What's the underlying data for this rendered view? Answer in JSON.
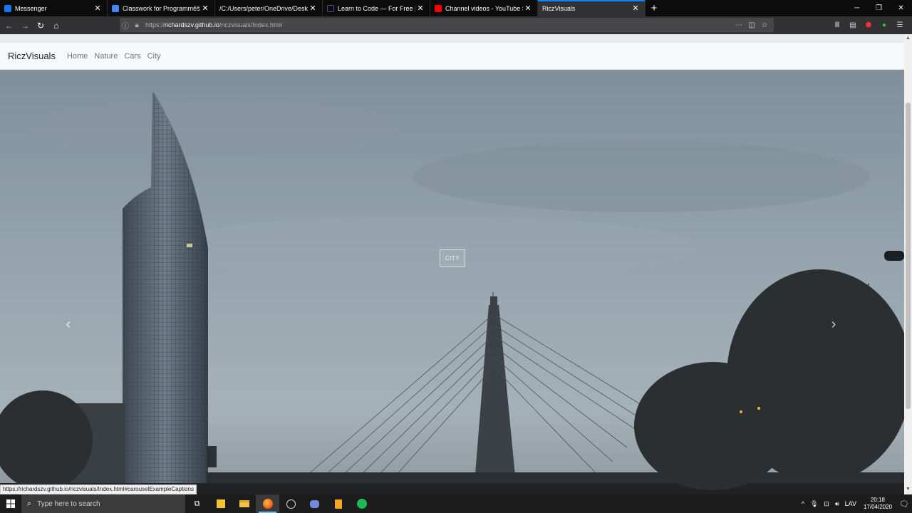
{
  "browser": {
    "tabs": [
      {
        "title": "Messenger",
        "color": "#1877f2",
        "active": false
      },
      {
        "title": "Classwork for ProgrammēšanasIz…",
        "color": "#4285f4",
        "active": false
      },
      {
        "title": "/C:/Users/peter/OneDrive/Desktop/",
        "color": "#323234",
        "active": false
      },
      {
        "title": "Learn to Code — For Free | Code",
        "color": "#0a0a23",
        "active": false
      },
      {
        "title": "Channel videos - YouTube Stud…",
        "color": "#ff0000",
        "active": false
      },
      {
        "title": "RiczVisuals",
        "color": "#323234",
        "active": true
      }
    ],
    "new_tab": "+",
    "close_glyph": "✕",
    "url_prefix": "https://",
    "url_host": "richardszv.github.io",
    "url_path": "/riczvisuals/Index.html",
    "status_url": "https://richardszv.github.io/riczvisuals/Index.html#carouselExampleCaptions"
  },
  "site": {
    "brand": "RiczVisuals",
    "nav": [
      "Home",
      "Nature",
      "Cars",
      "City"
    ],
    "caption": "CITY",
    "prev": "‹",
    "next": "›"
  },
  "taskbar": {
    "search_placeholder": "Type here to search",
    "language": "LAV",
    "time": "20:18",
    "date": "17/04/2020"
  },
  "colors": {
    "accent": "#0a84ff",
    "chrome_dark": "#0c0c0d",
    "toolbar": "#323234",
    "sky": "#8a9aa6"
  }
}
